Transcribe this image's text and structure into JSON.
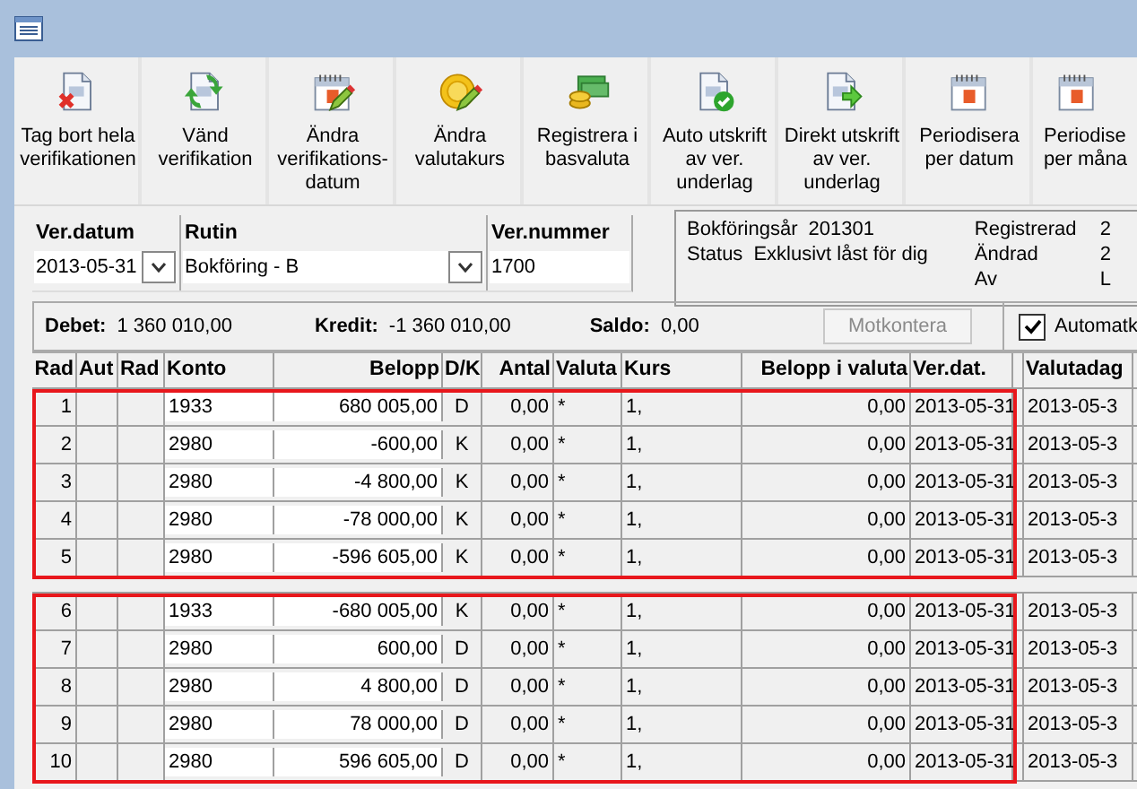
{
  "toolbar": [
    {
      "kind": "delete-doc",
      "label": "Tag bort hela verifikationen"
    },
    {
      "kind": "flip-doc",
      "label": "Vänd verifikation"
    },
    {
      "kind": "calendar-edit",
      "label": "Ändra verifikations-datum"
    },
    {
      "kind": "coin-edit",
      "label": "Ändra valutakurs"
    },
    {
      "kind": "money",
      "label": "Registrera i basvaluta"
    },
    {
      "kind": "check-doc",
      "label": "Auto utskrift av ver. underlag"
    },
    {
      "kind": "arrow-doc",
      "label": "Direkt utskrift av ver. underlag"
    },
    {
      "kind": "calendar",
      "label": "Periodisera per datum"
    },
    {
      "kind": "calendar",
      "label": "Periodise per måna"
    }
  ],
  "fields": [
    {
      "label": "Ver.datum",
      "value": "2013-05-31",
      "dropdown": true
    },
    {
      "label": "Rutin",
      "value": "Bokföring - B",
      "dropdown": true
    },
    {
      "label": "Ver.nummer",
      "value": "1700",
      "dropdown": false
    }
  ],
  "info": {
    "left": [
      {
        "label": "Bokföringsår",
        "value": "201301"
      },
      {
        "label": "Status",
        "value": "Exklusivt låst för dig"
      }
    ],
    "right": [
      {
        "label": "Registrerad",
        "value": "2"
      },
      {
        "label": "Ändrad",
        "value": "2"
      },
      {
        "label": "Av",
        "value": "L"
      }
    ]
  },
  "summary": {
    "debet_label": "Debet:",
    "debet": "1 360 010,00",
    "kredit_label": "Kredit:",
    "kredit": "-1 360 010,00",
    "saldo_label": "Saldo:",
    "saldo": "0,00",
    "button": "Motkontera",
    "checkbox": {
      "label": "Automatk",
      "checked": true
    }
  },
  "table": {
    "columns": [
      "Rad",
      "Aut",
      "Rad",
      "Konto",
      "Belopp",
      "D/K",
      "Antal",
      "Valuta",
      "Kurs",
      "Belopp i valuta",
      "Ver.dat.",
      "Valutadag"
    ],
    "groups": [
      {
        "highlighted": true,
        "rows": [
          [
            "1",
            "",
            "",
            "1933",
            "680 005,00",
            "D",
            "0,00",
            "*",
            "1,",
            "0,00",
            "2013-05-31",
            "2013-05-3"
          ],
          [
            "2",
            "",
            "",
            "2980",
            "-600,00",
            "K",
            "0,00",
            "*",
            "1,",
            "0,00",
            "2013-05-31",
            "2013-05-3"
          ],
          [
            "3",
            "",
            "",
            "2980",
            "-4 800,00",
            "K",
            "0,00",
            "*",
            "1,",
            "0,00",
            "2013-05-31",
            "2013-05-3"
          ],
          [
            "4",
            "",
            "",
            "2980",
            "-78 000,00",
            "K",
            "0,00",
            "*",
            "1,",
            "0,00",
            "2013-05-31",
            "2013-05-3"
          ],
          [
            "5",
            "",
            "",
            "2980",
            "-596 605,00",
            "K",
            "0,00",
            "*",
            "1,",
            "0,00",
            "2013-05-31",
            "2013-05-3"
          ]
        ]
      },
      {
        "highlighted": true,
        "rows": [
          [
            "6",
            "",
            "",
            "1933",
            "-680 005,00",
            "K",
            "0,00",
            "*",
            "1,",
            "0,00",
            "2013-05-31",
            "2013-05-3"
          ],
          [
            "7",
            "",
            "",
            "2980",
            "600,00",
            "D",
            "0,00",
            "*",
            "1,",
            "0,00",
            "2013-05-31",
            "2013-05-3"
          ],
          [
            "8",
            "",
            "",
            "2980",
            "4 800,00",
            "D",
            "0,00",
            "*",
            "1,",
            "0,00",
            "2013-05-31",
            "2013-05-3"
          ],
          [
            "9",
            "",
            "",
            "2980",
            "78 000,00",
            "D",
            "0,00",
            "*",
            "1,",
            "0,00",
            "2013-05-31",
            "2013-05-3"
          ],
          [
            "10",
            "",
            "",
            "2980",
            "596 605,00",
            "D",
            "0,00",
            "*",
            "1,",
            "0,00",
            "2013-05-31",
            "2013-05-3"
          ]
        ]
      }
    ]
  }
}
